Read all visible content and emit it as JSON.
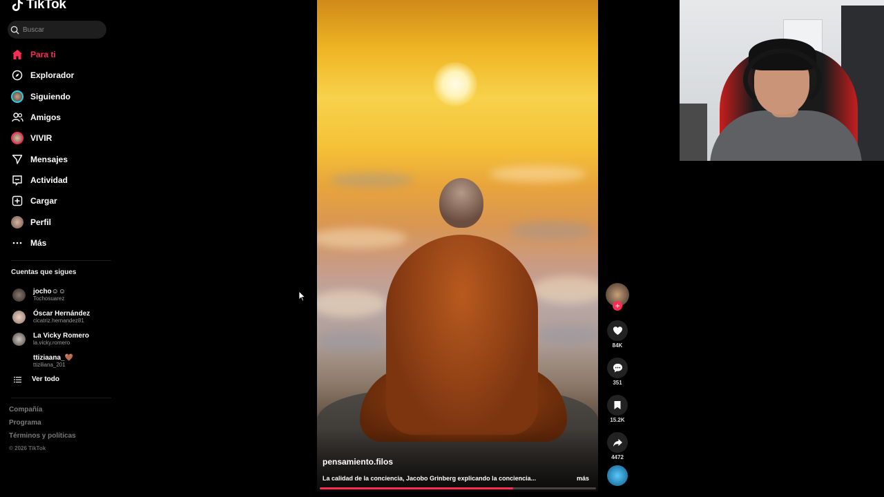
{
  "app": {
    "brand": "TikTok",
    "accent": "#fe2c55"
  },
  "search": {
    "placeholder": "Buscar"
  },
  "nav": [
    {
      "label": "Para ti",
      "icon": "home-icon",
      "active": true
    },
    {
      "label": "Explorador",
      "icon": "compass-icon"
    },
    {
      "label": "Siguiendo",
      "icon": "following-avatar-icon"
    },
    {
      "label": "Amigos",
      "icon": "friends-icon"
    },
    {
      "label": "VIVIR",
      "icon": "live-avatar-icon"
    },
    {
      "label": "Mensajes",
      "icon": "send-icon"
    },
    {
      "label": "Actividad",
      "icon": "activity-icon"
    },
    {
      "label": "Cargar",
      "icon": "upload-icon"
    },
    {
      "label": "Perfil",
      "icon": "profile-avatar-icon"
    },
    {
      "label": "Más",
      "icon": "more-icon"
    }
  ],
  "following": {
    "title": "Cuentas que sigues",
    "accounts": [
      {
        "name": "jocho☺☺",
        "handle": "Tochosuarez"
      },
      {
        "name": "Óscar Hernández",
        "handle": "cicatriz.hernandez81"
      },
      {
        "name": "La Vicky Romero",
        "handle": "la.vicky.romero"
      },
      {
        "name": "ttiziaana_🤎",
        "handle": "ttiziliana_201"
      }
    ],
    "see_all": "Ver todo"
  },
  "footer": {
    "links": [
      "Compañía",
      "Programa",
      "Términos y políticas"
    ],
    "copyright": "© 2026 TikTok"
  },
  "video": {
    "author": "pensamiento.filos",
    "caption": "La calidad de la conciencia, Jacobo Grinberg explicando la conciencia...",
    "more": "más",
    "progress": 0.7
  },
  "actions": {
    "likes": "84K",
    "comments": "351",
    "saves": "15.2K",
    "shares": "4472"
  }
}
